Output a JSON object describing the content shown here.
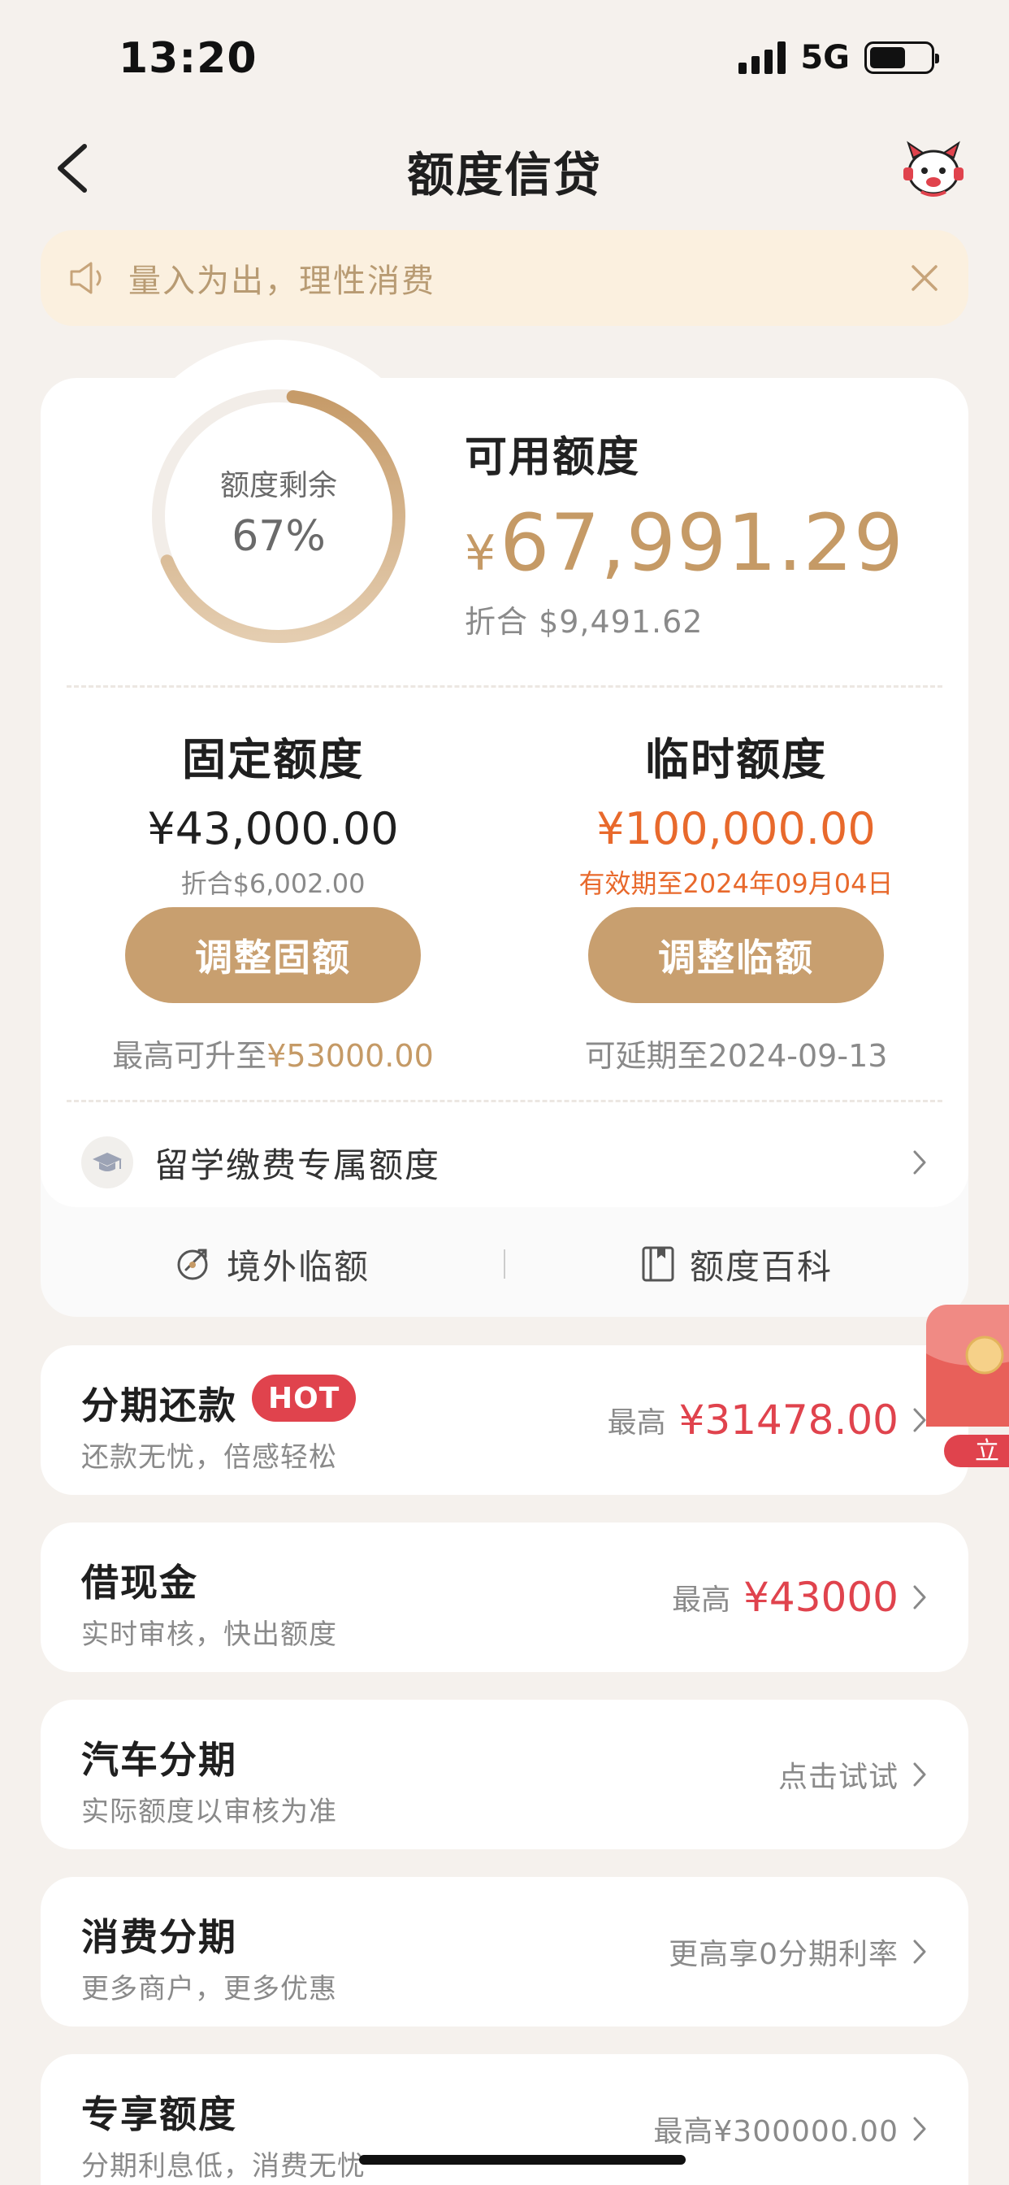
{
  "status_bar": {
    "time": "13:20",
    "network": "5G"
  },
  "nav": {
    "title": "额度信贷"
  },
  "notice": {
    "text": "量入为出，理性消费"
  },
  "credit": {
    "ring_label": "额度剩余",
    "ring_percent": "67%",
    "ring_fraction": 0.67,
    "available_label": "可用额度",
    "currency_symbol": "¥",
    "available_amount": "67,991.29",
    "available_equiv": "折合  $9,491.62",
    "fixed": {
      "title": "固定额度",
      "amount": "¥43,000.00",
      "sub": "折合$6,002.00",
      "button": "调整固额",
      "foot_prefix": "最高可升至",
      "foot_value": "¥53000.00"
    },
    "temp": {
      "title": "临时额度",
      "amount": "¥100,000.00",
      "sub": "有效期至2024年09月04日",
      "button": "调整临额",
      "foot": "可延期至2024-09-13"
    },
    "study_label": "留学缴费专属额度",
    "links": {
      "overseas": "境外临额",
      "wiki": "额度百科"
    }
  },
  "products": [
    {
      "title": "分期还款",
      "badge": "HOT",
      "sub": "还款无忧，倍感轻松",
      "prefix": "最高",
      "value": "¥31478.00"
    },
    {
      "title": "借现金",
      "sub": "实时审核，快出额度",
      "prefix": "最高",
      "value": "¥43000"
    },
    {
      "title": "汽车分期",
      "sub": "实际额度以审核为准",
      "text": "点击试试"
    },
    {
      "title": "消费分期",
      "sub": "更多商户，更多优惠",
      "text": "更高享0分期利率"
    },
    {
      "title": "专享额度",
      "sub": "分期利息低，消费无忧",
      "text": "最高¥300000.00"
    }
  ],
  "floating": {
    "redpacket_text": "立"
  },
  "colors": {
    "gold": "#c59a66",
    "button": "#c89f6f",
    "red": "#e0434d",
    "orange": "#e8692c",
    "notice_bg": "#fbf0df"
  }
}
